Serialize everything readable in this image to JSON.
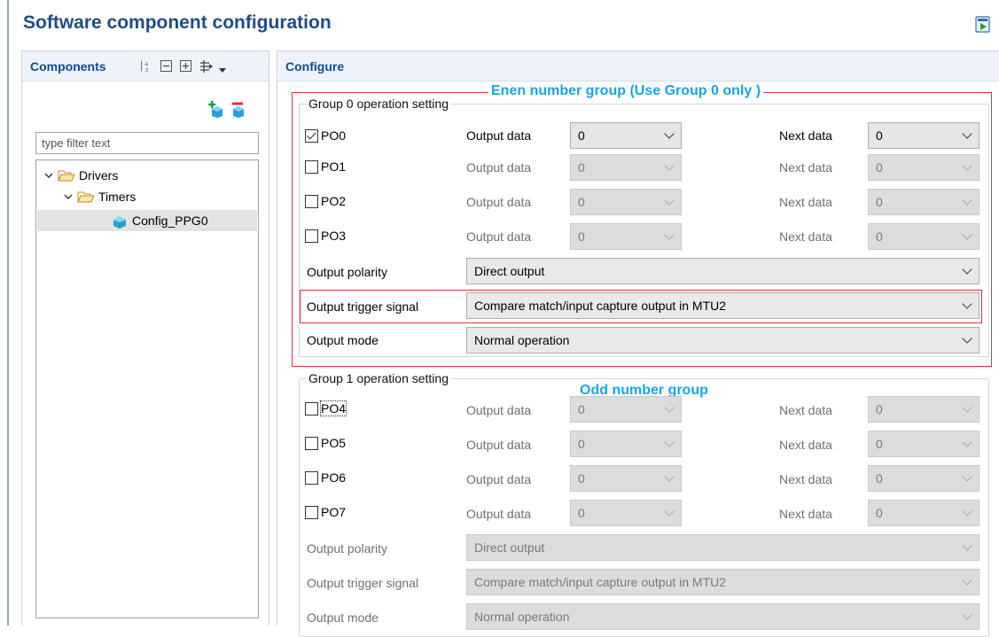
{
  "title": "Software component configuration",
  "components": {
    "label": "Components",
    "filter_placeholder": "type filter text",
    "tree": [
      {
        "label": "Drivers"
      },
      {
        "label": "Timers"
      },
      {
        "label": "Config_PPG0"
      }
    ]
  },
  "configure": {
    "label": "Configure",
    "annotation_even": "Enen number group (Use Group 0 only )",
    "annotation_odd": "Odd number group",
    "group0": {
      "legend": "Group 0 operation setting",
      "pins": [
        {
          "name": "PO0",
          "checked": true,
          "output_label": "Output data",
          "output_value": "0",
          "next_label": "Next data",
          "next_value": "0"
        },
        {
          "name": "PO1",
          "checked": false,
          "output_label": "Output data",
          "output_value": "0",
          "next_label": "Next data",
          "next_value": "0"
        },
        {
          "name": "PO2",
          "checked": false,
          "output_label": "Output data",
          "output_value": "0",
          "next_label": "Next data",
          "next_value": "0"
        },
        {
          "name": "PO3",
          "checked": false,
          "output_label": "Output data",
          "output_value": "0",
          "next_label": "Next data",
          "next_value": "0"
        }
      ],
      "polarity_label": "Output polarity",
      "polarity_value": "Direct output",
      "trigger_label": "Output trigger signal",
      "trigger_value": "Compare match/input capture output in MTU2",
      "mode_label": "Output mode",
      "mode_value": "Normal operation"
    },
    "group1": {
      "legend": "Group 1 operation setting",
      "pins": [
        {
          "name": "PO4",
          "checked": false,
          "output_label": "Output data",
          "output_value": "0",
          "next_label": "Next data",
          "next_value": "0"
        },
        {
          "name": "PO5",
          "checked": false,
          "output_label": "Output data",
          "output_value": "0",
          "next_label": "Next data",
          "next_value": "0"
        },
        {
          "name": "PO6",
          "checked": false,
          "output_label": "Output data",
          "output_value": "0",
          "next_label": "Next data",
          "next_value": "0"
        },
        {
          "name": "PO7",
          "checked": false,
          "output_label": "Output data",
          "output_value": "0",
          "next_label": "Next data",
          "next_value": "0"
        }
      ],
      "polarity_label": "Output polarity",
      "polarity_value": "Direct output",
      "trigger_label": "Output trigger signal",
      "trigger_value": "Compare match/input capture output in MTU2",
      "mode_label": "Output mode",
      "mode_value": "Normal operation"
    }
  }
}
